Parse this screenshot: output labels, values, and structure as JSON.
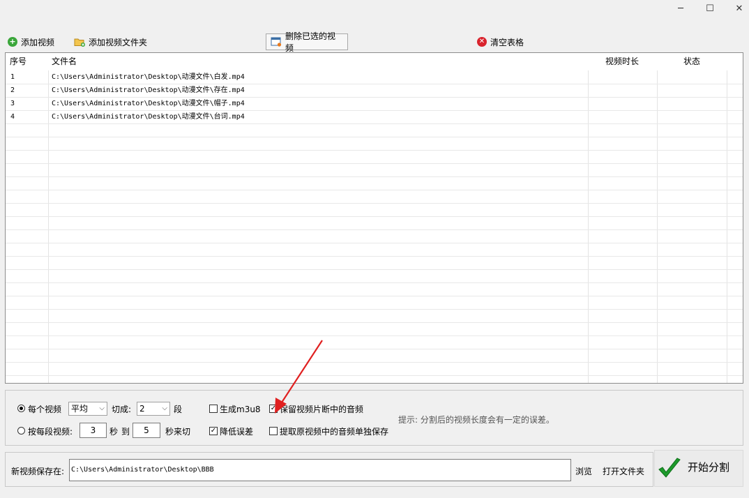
{
  "window": {
    "controls": {
      "minimize": "─",
      "maximize": "☐",
      "close": "✕"
    }
  },
  "toolbar": {
    "add_video": "添加视频",
    "add_folder": "添加视频文件夹",
    "delete_selected": "删除已选的视频",
    "clear_table": "清空表格"
  },
  "table": {
    "columns": {
      "index": "序号",
      "filename": "文件名",
      "duration": "视频时长",
      "status": "状态"
    },
    "rows": [
      {
        "index": "1",
        "filename": "C:\\Users\\Administrator\\Desktop\\动漫文件\\白发.mp4",
        "duration": "",
        "status": ""
      },
      {
        "index": "2",
        "filename": "C:\\Users\\Administrator\\Desktop\\动漫文件\\存在.mp4",
        "duration": "",
        "status": ""
      },
      {
        "index": "3",
        "filename": "C:\\Users\\Administrator\\Desktop\\动漫文件\\帽子.mp4",
        "duration": "",
        "status": ""
      },
      {
        "index": "4",
        "filename": "C:\\Users\\Administrator\\Desktop\\动漫文件\\台词.mp4",
        "duration": "",
        "status": ""
      }
    ]
  },
  "options": {
    "mode_each_video": "每个视频",
    "split_method": "平均",
    "cut_into_label": "切成:",
    "segments_value": "2",
    "segments_unit": "段",
    "mode_per_segment": "按每段视频:",
    "seconds_value": "3",
    "seconds_unit": "秒",
    "to_label": "到",
    "to_value": "5",
    "seconds_cut_label": "秒来切",
    "gen_m3u8": "生成m3u8",
    "reduce_error": "降低误差",
    "keep_audio": "保留视频片断中的音频",
    "extract_audio": "提取原视频中的音频单独保存",
    "hint": "提示: 分割后的视频长度会有一定的误差。",
    "state": {
      "mode": "each_video",
      "gen_m3u8": false,
      "reduce_error": true,
      "keep_audio": true,
      "extract_audio": false
    }
  },
  "save": {
    "label": "新视频保存在:",
    "path": "C:\\Users\\Administrator\\Desktop\\BBB",
    "browse": "浏览",
    "open_folder": "打开文件夹",
    "start": "开始分割"
  },
  "colors": {
    "add_icon": "#3aa63a",
    "clear_icon": "#d9232d",
    "check_green": "#1d9a2b",
    "arrow_red": "#e02020"
  }
}
